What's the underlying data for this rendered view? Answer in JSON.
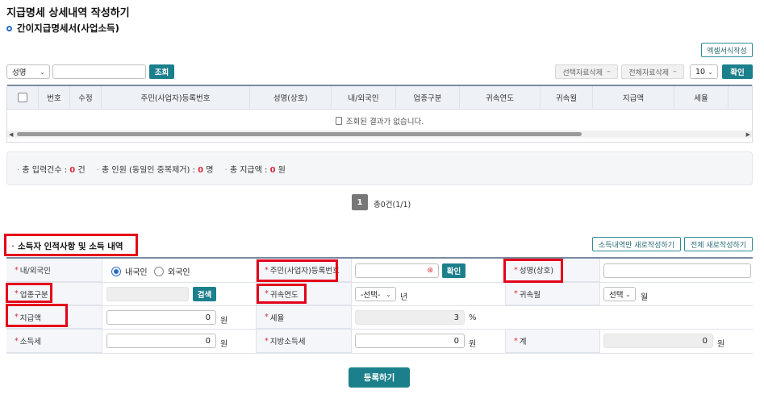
{
  "page": {
    "title": "지급명세 상세내역 작성하기",
    "subtitle": "간이지급명세서(사업소득)"
  },
  "toolbar": {
    "excel_button": "엑셀서식작성",
    "search_select": "성명",
    "search_input": "",
    "search_button": "조회",
    "delete_selected": "선택자료삭제",
    "delete_all": "전체자료삭제",
    "page_size": "10",
    "confirm_button": "확인"
  },
  "grid": {
    "columns": [
      "번호",
      "수정",
      "주민(사업자)등록번호",
      "성명(상호)",
      "내/외국인",
      "업종구분",
      "귀속연도",
      "귀속월",
      "지급액",
      "세율"
    ],
    "empty_message": "조회된 결과가 없습니다."
  },
  "summary": {
    "input_count_label": "총 입력건수 :",
    "input_count_value": "0",
    "input_count_unit": "건",
    "people_label": "총 인원 (동일인 중복제거) :",
    "people_value": "0",
    "people_unit": "명",
    "amount_label": "총 지급액 :",
    "amount_value": "0",
    "amount_unit": "원"
  },
  "pagination": {
    "current_page": "1",
    "total_text": "총0건(1/1)"
  },
  "form": {
    "section_title": "소득자 인적사항 및 소득 내역",
    "new_income_only": "소득내역만 새로작성하기",
    "new_all": "전체 새로작성하기",
    "labels": {
      "nationality": "내/외국인",
      "reg_no": "주민(사업자)등록번호",
      "name": "성명(상호)",
      "industry": "업종구분",
      "year": "귀속연도",
      "month": "귀속월",
      "amount": "지급액",
      "tax_rate": "세율",
      "income_tax": "소득세",
      "local_tax": "지방소득세",
      "total": "계"
    },
    "radio_domestic": "내국인",
    "radio_foreign": "외국인",
    "confirm_button": "확인",
    "search_button": "검색",
    "year_select": "-선택-",
    "year_unit": "년",
    "month_select": "선택",
    "month_unit": "월",
    "amount_value": "0",
    "won": "원",
    "tax_rate_value": "3",
    "percent": "%",
    "income_tax_value": "0",
    "local_tax_value": "0",
    "total_value": "0",
    "submit_button": "등록하기"
  },
  "colors": {
    "accent": "#1c7f8c",
    "required": "#d72b3a",
    "highlight": "#e4001a"
  }
}
